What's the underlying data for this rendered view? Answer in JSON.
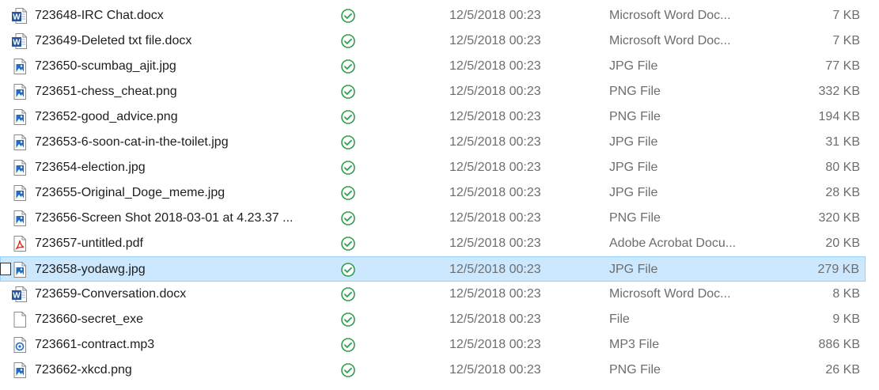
{
  "files": [
    {
      "name": "723648-IRC Chat.docx",
      "icon": "word-doc-icon",
      "status": "synced-check-icon",
      "date": "12/5/2018 00:23",
      "type": "Microsoft Word Doc...",
      "size": "7 KB",
      "selected": false
    },
    {
      "name": "723649-Deleted txt file.docx",
      "icon": "word-doc-icon",
      "status": "synced-check-icon",
      "date": "12/5/2018 00:23",
      "type": "Microsoft Word Doc...",
      "size": "7 KB",
      "selected": false
    },
    {
      "name": "723650-scumbag_ajit.jpg",
      "icon": "image-file-icon",
      "status": "synced-check-icon",
      "date": "12/5/2018 00:23",
      "type": "JPG File",
      "size": "77 KB",
      "selected": false
    },
    {
      "name": "723651-chess_cheat.png",
      "icon": "image-file-icon",
      "status": "synced-check-icon",
      "date": "12/5/2018 00:23",
      "type": "PNG File",
      "size": "332 KB",
      "selected": false
    },
    {
      "name": "723652-good_advice.png",
      "icon": "image-file-icon",
      "status": "synced-check-icon",
      "date": "12/5/2018 00:23",
      "type": "PNG File",
      "size": "194 KB",
      "selected": false
    },
    {
      "name": "723653-6-soon-cat-in-the-toilet.jpg",
      "icon": "image-file-icon",
      "status": "synced-check-icon",
      "date": "12/5/2018 00:23",
      "type": "JPG File",
      "size": "31 KB",
      "selected": false
    },
    {
      "name": "723654-election.jpg",
      "icon": "image-file-icon",
      "status": "synced-check-icon",
      "date": "12/5/2018 00:23",
      "type": "JPG File",
      "size": "80 KB",
      "selected": false
    },
    {
      "name": "723655-Original_Doge_meme.jpg",
      "icon": "image-file-icon",
      "status": "synced-check-icon",
      "date": "12/5/2018 00:23",
      "type": "JPG File",
      "size": "28 KB",
      "selected": false
    },
    {
      "name": "723656-Screen Shot 2018-03-01 at 4.23.37 ...",
      "icon": "image-file-icon",
      "status": "synced-check-icon",
      "date": "12/5/2018 00:23",
      "type": "PNG File",
      "size": "320 KB",
      "selected": false
    },
    {
      "name": "723657-untitled.pdf",
      "icon": "pdf-file-icon",
      "status": "synced-check-icon",
      "date": "12/5/2018 00:23",
      "type": "Adobe Acrobat Docu...",
      "size": "20 KB",
      "selected": false
    },
    {
      "name": "723658-yodawg.jpg",
      "icon": "image-file-icon",
      "status": "synced-check-icon",
      "date": "12/5/2018 00:23",
      "type": "JPG File",
      "size": "279 KB",
      "selected": true
    },
    {
      "name": "723659-Conversation.docx",
      "icon": "word-doc-icon",
      "status": "synced-check-icon",
      "date": "12/5/2018 00:23",
      "type": "Microsoft Word Doc...",
      "size": "8 KB",
      "selected": false
    },
    {
      "name": "723660-secret_exe",
      "icon": "blank-file-icon",
      "status": "synced-check-icon",
      "date": "12/5/2018 00:23",
      "type": "File",
      "size": "9 KB",
      "selected": false
    },
    {
      "name": "723661-contract.mp3",
      "icon": "audio-file-icon",
      "status": "synced-check-icon",
      "date": "12/5/2018 00:23",
      "type": "MP3 File",
      "size": "886 KB",
      "selected": false
    },
    {
      "name": "723662-xkcd.png",
      "icon": "image-file-icon",
      "status": "synced-check-icon",
      "date": "12/5/2018 00:23",
      "type": "PNG File",
      "size": "26 KB",
      "selected": false
    }
  ],
  "colors": {
    "selection_bg": "#cce8ff",
    "selection_border": "#99d1ff",
    "status_green": "#2e9e4a",
    "word_blue": "#2b579a",
    "image_blue": "#1e6fc2",
    "pdf_red": "#d93025",
    "secondary_text": "#6d6d6d"
  }
}
